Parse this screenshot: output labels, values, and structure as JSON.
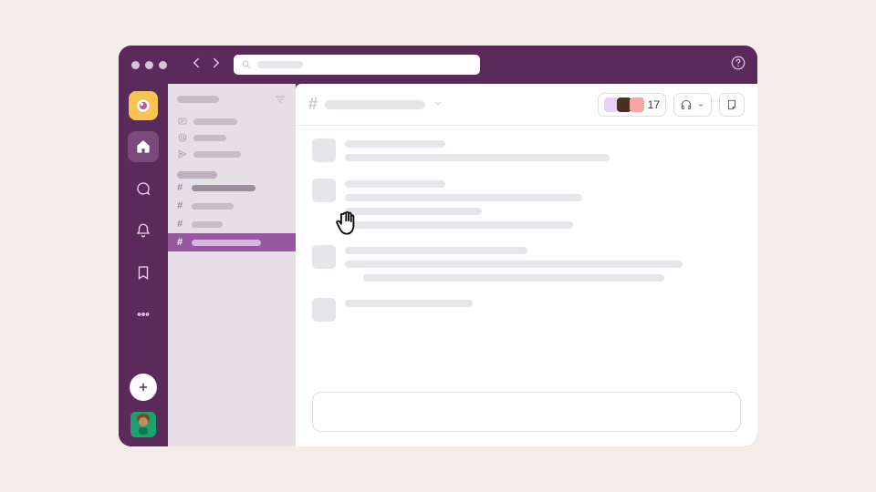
{
  "colors": {
    "brand": "#592a5a",
    "accent": "#9657a1",
    "workspace_tile": "#f6c453"
  },
  "header": {
    "search_placeholder": ""
  },
  "rail": {
    "items": [
      {
        "name": "home",
        "active": true
      },
      {
        "name": "dms",
        "active": false
      },
      {
        "name": "activity",
        "active": false
      },
      {
        "name": "later",
        "active": false
      },
      {
        "name": "more",
        "active": false
      }
    ]
  },
  "sidebar": {
    "quick": [
      {
        "icon": "threads"
      },
      {
        "icon": "mentions"
      },
      {
        "icon": "drafts"
      }
    ],
    "channels": [
      {
        "bold": true,
        "active": false
      },
      {
        "bold": false,
        "active": false
      },
      {
        "bold": false,
        "active": false
      },
      {
        "bold": false,
        "active": true
      }
    ]
  },
  "channel_header": {
    "hash": "#",
    "member_count": "17"
  },
  "messages": [
    {
      "lines": [
        110,
        290
      ]
    },
    {
      "lines": [
        110,
        260,
        150,
        250
      ]
    },
    {
      "lines": [
        200,
        370,
        330
      ]
    },
    {
      "lines": [
        140
      ]
    }
  ]
}
